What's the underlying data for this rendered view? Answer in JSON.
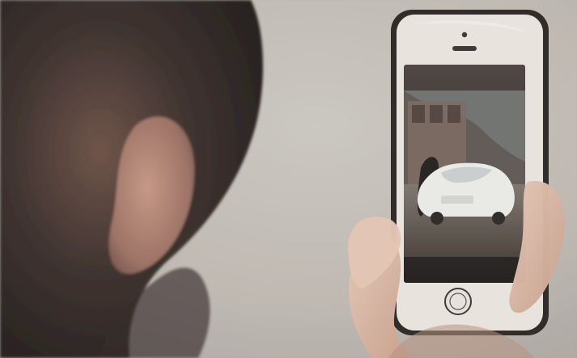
{
  "scene": {
    "colors": {
      "background_wall": "#c9c4bd",
      "phone_frame": "#2a2624",
      "phone_face": "#e8e3dc",
      "screen_dark": "#2d2a28",
      "car_white": "#e9e9e6",
      "hand_skin": "#d9b8a3",
      "hair_dark": "#2b2421"
    },
    "icons": [
      "phone-earpiece-icon",
      "home-button-icon",
      "camera-dot-icon"
    ]
  }
}
